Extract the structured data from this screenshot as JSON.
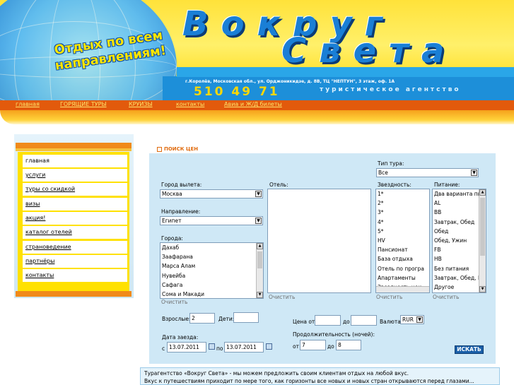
{
  "banner": {
    "title_line1": "Вокруг",
    "title_line2": "Света",
    "slogan_line1": "Отдых по всем",
    "slogan_line2": "направлениям!",
    "address": "г.Королёв, Московская обл., ул. Орджоникидзе, д. 8В, ТЦ \"НЕПТУН\", 3 этаж, оф. 1А",
    "phone": "510 49 71",
    "agency": "туристическое агентство"
  },
  "topnav": [
    "главная",
    "ГОРЯЩИЕ ТУРЫ",
    "КРУИЗЫ",
    "контакты",
    "Авиа и Ж/Д билеты"
  ],
  "sidebar": {
    "items": [
      "главная",
      "услуги",
      "туры со скидкой",
      "визы",
      "акция!",
      "каталог отелей",
      "страноведение",
      "партнёры",
      "контакты"
    ]
  },
  "search": {
    "heading": "ПОИСК ЦЕН",
    "tour_type_label": "Тип тура:",
    "tour_type_value": "Все",
    "departure_label": "Город вылета:",
    "departure_value": "Москва",
    "hotel_label": "Отель:",
    "stars_label": "Звездность:",
    "meal_label": "Питание:",
    "direction_label": "Направление:",
    "direction_value": "Египет",
    "cities_label": "Города:",
    "cities": [
      "Дахаб",
      "Заафарана",
      "Марса Алам",
      "Нувейба",
      "Сафага",
      "Сома и Макади"
    ],
    "stars": [
      "1*",
      "2*",
      "3*",
      "4*",
      "5*",
      "HV",
      "Пансионат",
      "База отдыха",
      "Отель по програ",
      "Апартаменты",
      "Звездность неи"
    ],
    "meals": [
      "Два варианта пи",
      "AL",
      "BB",
      "Завтрак, Обед",
      "Обед",
      "Обед, Ужин",
      "FB",
      "HB",
      "Без питания",
      "Завтрак, Обед, I",
      "Другое"
    ],
    "clear_label": "Очистить",
    "adults_label": "Взрослые:",
    "adults_value": "2",
    "children_label": "Дети:",
    "children_value": "",
    "price_from_label": "Цена от",
    "price_to_label": "до",
    "currency_label": "Валюта",
    "currency_value": "RUR",
    "date_label": "Дата заезда:",
    "date_from_label": "с",
    "date_from": "13.07.2011",
    "date_to_label": "по",
    "date_to": "13.07.2011",
    "duration_label": "Продолжительность (ночей):",
    "nights_from_label": "от",
    "nights_from": "7",
    "nights_to_label": "до",
    "nights_to": "8",
    "search_button": "ИСКАТЬ"
  },
  "about": {
    "line1": "Турагентство «Вокруг Света» - мы можем предложить своим клиентам отдых на любой вкус.",
    "line2": "Вкус к путешествиям приходит по мере того, как горизонты все новых и новых стран открываются перед глазами..."
  },
  "colors": {
    "banner_yellow": "#ffe23a",
    "banner_blue": "#1a7fd6",
    "nav_orange": "#e25a0c",
    "sidebar_yellow": "#ffe100",
    "panel_blue": "#cfe8f6",
    "button_blue": "#1a5fa8"
  },
  "icons": [
    "dropdown-arrow-icon",
    "calendar-icon",
    "scroll-up-icon",
    "scroll-down-icon"
  ]
}
